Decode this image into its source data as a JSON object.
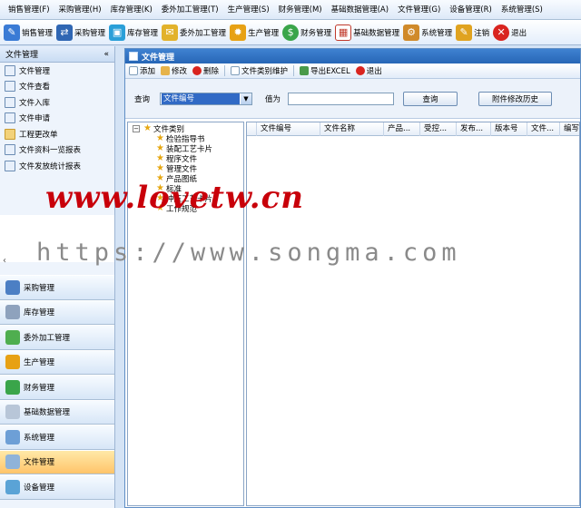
{
  "menubar": {
    "items": [
      "销售管理(F)",
      "采购管理(H)",
      "库存管理(K)",
      "委外加工管理(T)",
      "生产管理(S)",
      "财务管理(M)",
      "基础数据管理(A)",
      "文件管理(G)",
      "设备管理(R)",
      "系统管理(S)"
    ]
  },
  "toolbar": {
    "items": [
      {
        "label": "销售管理",
        "icon": "sales-icon",
        "color": "#3a7bd5"
      },
      {
        "label": "采购管理",
        "icon": "purchase-icon",
        "color": "#2f66b3"
      },
      {
        "label": "库存管理",
        "icon": "inventory-icon",
        "color": "#2a9fd8"
      },
      {
        "label": "委外加工管理",
        "icon": "outsource-icon",
        "color": "#e2b22b"
      },
      {
        "label": "生产管理",
        "icon": "production-icon",
        "color": "#e7a114"
      },
      {
        "label": "财务管理",
        "icon": "finance-icon",
        "color": "#3aa54a"
      },
      {
        "label": "基础数据管理",
        "icon": "calendar-icon",
        "color": "#c0392b"
      },
      {
        "label": "系统管理",
        "icon": "system-icon",
        "color": "#d08a2a"
      },
      {
        "label": "注销",
        "icon": "logout-icon",
        "color": "#e0a320"
      },
      {
        "label": "退出",
        "icon": "exit-icon",
        "color": "#d9241f"
      }
    ]
  },
  "sidebar": {
    "title": "文件管理",
    "collapse_glyph": "«",
    "items": [
      "文件管理",
      "文件查看",
      "文件入库",
      "文件申请",
      "工程更改单",
      "文件资料一览报表",
      "文件发放统计报表"
    ],
    "modules": [
      {
        "label": "采购管理",
        "active": false
      },
      {
        "label": "库存管理",
        "active": false
      },
      {
        "label": "委外加工管理",
        "active": false
      },
      {
        "label": "生产管理",
        "active": false
      },
      {
        "label": "财务管理",
        "active": false
      },
      {
        "label": "基础数据管理",
        "active": false
      },
      {
        "label": "系统管理",
        "active": false
      },
      {
        "label": "文件管理",
        "active": true
      },
      {
        "label": "设备管理",
        "active": false
      }
    ]
  },
  "window": {
    "title": "文件管理",
    "toolbar": [
      "添加",
      "修改",
      "删除",
      "文件类别维护",
      "导出EXCEL",
      "退出"
    ],
    "query": {
      "label": "查询",
      "field_value": "文件编号",
      "value_label": "值为",
      "value": "",
      "search_button": "查询",
      "history_button": "附件修改历史"
    },
    "tree": {
      "root": "文件类别",
      "children": [
        "检验指导书",
        "装配工艺卡片",
        "程序文件",
        "管理文件",
        "产品图纸",
        "标准",
        "冲压工艺卡片",
        "工作规范"
      ]
    },
    "columns": [
      "文件编号",
      "文件名称",
      "产品...",
      "受控...",
      "发布...",
      "版本号",
      "文件...",
      "编写..."
    ]
  },
  "watermarks": {
    "primary": "www.lovetw.cn",
    "secondary": "https://www.songma.com"
  }
}
